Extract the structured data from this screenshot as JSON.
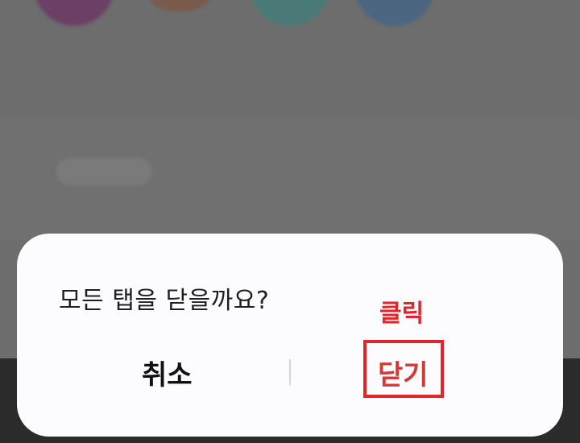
{
  "dialog": {
    "title": "모든 탭을 닫을까요?",
    "cancel_label": "취소",
    "close_label": "닫기"
  },
  "annotation": {
    "text": "클릭",
    "color": "#e0262b"
  },
  "colors": {
    "scrim": "#6d6d6d",
    "dialog_background": "#fcfcfe",
    "close_text": "#d23a36"
  }
}
